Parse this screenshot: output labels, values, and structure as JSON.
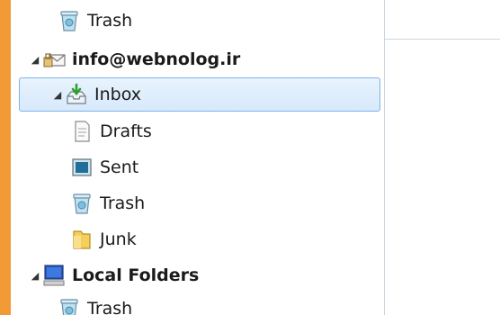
{
  "colors": {
    "accent_bar": "#f29a35",
    "selection_bg": "#dcecfc",
    "selection_border": "#7eb4ea"
  },
  "folder_tree": {
    "items": [
      {
        "label": "Trash",
        "icon": "trash-icon",
        "level": "folder"
      },
      {
        "label": "info@webnolog.ir",
        "icon": "mail-account-icon",
        "level": "account",
        "expanded": true,
        "bold": true
      },
      {
        "label": "Inbox",
        "icon": "inbox-icon",
        "level": "folder",
        "expanded": true,
        "selected": true
      },
      {
        "label": "Drafts",
        "icon": "drafts-icon",
        "level": "subfolder"
      },
      {
        "label": "Sent",
        "icon": "sent-icon",
        "level": "subfolder"
      },
      {
        "label": "Trash",
        "icon": "trash-icon",
        "level": "subfolder"
      },
      {
        "label": "Junk",
        "icon": "junk-folder-icon",
        "level": "subfolder"
      },
      {
        "label": "Local Folders",
        "icon": "local-folders-icon",
        "level": "account",
        "expanded": true,
        "bold": true
      },
      {
        "label": "Trash",
        "icon": "trash-icon",
        "level": "folder"
      }
    ]
  }
}
